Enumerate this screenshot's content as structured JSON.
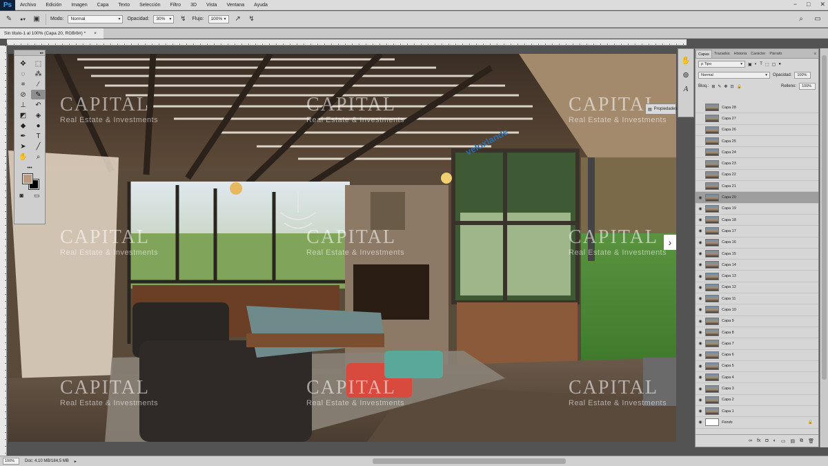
{
  "app": {
    "logo": "Ps"
  },
  "menubar": {
    "items": [
      "Archivo",
      "Edición",
      "Imagen",
      "Capa",
      "Texto",
      "Selección",
      "Filtro",
      "3D",
      "Vista",
      "Ventana",
      "Ayuda"
    ],
    "window_controls": [
      "−",
      "□",
      "✕"
    ]
  },
  "options_bar": {
    "mode_label": "Modo:",
    "mode_value": "Normal",
    "opacity_label": "Opacidad:",
    "opacity_value": "30%",
    "flow_label": "Flujo:",
    "flow_value": "100%"
  },
  "document": {
    "tab_title": "Sin título-1 al 100% (Capa 20, RGB/8#) *",
    "close_glyph": "×"
  },
  "toolbox": {
    "tools": [
      {
        "name": "move-tool-icon",
        "glyph": "✥"
      },
      {
        "name": "marquee-tool-icon",
        "glyph": "⬚"
      },
      {
        "name": "lasso-tool-icon",
        "glyph": "◌"
      },
      {
        "name": "magic-wand-tool-icon",
        "glyph": "⁂"
      },
      {
        "name": "crop-tool-icon",
        "glyph": "⌗"
      },
      {
        "name": "eyedropper-tool-icon",
        "glyph": "⁄"
      },
      {
        "name": "healing-brush-tool-icon",
        "glyph": "⊘"
      },
      {
        "name": "brush-tool-icon",
        "glyph": "✎",
        "active": true
      },
      {
        "name": "clone-stamp-tool-icon",
        "glyph": "⊥"
      },
      {
        "name": "history-brush-tool-icon",
        "glyph": "↶"
      },
      {
        "name": "eraser-tool-icon",
        "glyph": "◩"
      },
      {
        "name": "paint-bucket-tool-icon",
        "glyph": "◈"
      },
      {
        "name": "blur-tool-icon",
        "glyph": "◆"
      },
      {
        "name": "dodge-tool-icon",
        "glyph": "●"
      },
      {
        "name": "pen-tool-icon",
        "glyph": "✒"
      },
      {
        "name": "type-tool-icon",
        "glyph": "T"
      },
      {
        "name": "path-selection-tool-icon",
        "glyph": "➤"
      },
      {
        "name": "line-tool-icon",
        "glyph": "╱"
      },
      {
        "name": "hand-tool-icon",
        "glyph": "✋"
      },
      {
        "name": "zoom-tool-icon",
        "glyph": "⌕"
      }
    ],
    "more_glyph": "•••"
  },
  "canvas": {
    "watermarks": [
      {
        "title": "CAPITAL",
        "subtitle": "Real Estate & Investments"
      },
      {
        "title": "CAPITAL",
        "subtitle": "Real Estate & Investments"
      },
      {
        "title": "CAPITAL",
        "subtitle": "Real Estate & Investments"
      },
      {
        "title": "CAPITAL",
        "subtitle": "Real Estate & Investments"
      },
      {
        "title": "CAPITAL",
        "subtitle": "Real Estate & Investments"
      },
      {
        "title": "CAPITAL",
        "subtitle": "Real Estate & Investments"
      },
      {
        "title": "CAPITAL",
        "subtitle": "Real Estate & Investments"
      },
      {
        "title": "CAPITAL",
        "subtitle": "Real Estate & Investments"
      },
      {
        "title": "CAPITAL",
        "subtitle": "Real Estate & Investments"
      }
    ],
    "sign_text": "veloxlande",
    "nav_arrow": "›"
  },
  "properties_button": {
    "label": "Propiedades"
  },
  "layers_panel": {
    "tabs": [
      "Capas",
      "Trazados",
      "Historia",
      "Carácter",
      "Párrafo"
    ],
    "active_tab": "Capas",
    "filter_value": "ρ Tipo",
    "blend_value": "Normal",
    "opacity_label": "Opacidad:",
    "opacity_value": "100%",
    "lock_label": "Bloq.:",
    "fill_label": "Relleno:",
    "fill_value": "100%",
    "layers": [
      {
        "name": "Capa 28",
        "visible": false
      },
      {
        "name": "Capa 27",
        "visible": false
      },
      {
        "name": "Capa 26",
        "visible": false
      },
      {
        "name": "Capa 25",
        "visible": false
      },
      {
        "name": "Capa 24",
        "visible": false
      },
      {
        "name": "Capa 23",
        "visible": false
      },
      {
        "name": "Capa 22",
        "visible": false
      },
      {
        "name": "Capa 21",
        "visible": false
      },
      {
        "name": "Capa 20",
        "visible": true,
        "selected": true
      },
      {
        "name": "Capa 19",
        "visible": true
      },
      {
        "name": "Capa 18",
        "visible": true
      },
      {
        "name": "Capa 17",
        "visible": true
      },
      {
        "name": "Capa 16",
        "visible": true
      },
      {
        "name": "Capa 15",
        "visible": true
      },
      {
        "name": "Capa 14",
        "visible": true
      },
      {
        "name": "Capa 13",
        "visible": true
      },
      {
        "name": "Capa 12",
        "visible": true
      },
      {
        "name": "Capa 11",
        "visible": true
      },
      {
        "name": "Capa 10",
        "visible": true
      },
      {
        "name": "Capa 9",
        "visible": true
      },
      {
        "name": "Capa 8",
        "visible": true
      },
      {
        "name": "Capa 7",
        "visible": true
      },
      {
        "name": "Capa 6",
        "visible": true
      },
      {
        "name": "Capa 5",
        "visible": true
      },
      {
        "name": "Capa 4",
        "visible": true
      },
      {
        "name": "Capa 3",
        "visible": true
      },
      {
        "name": "Capa 2",
        "visible": true
      },
      {
        "name": "Capa 1",
        "visible": true
      },
      {
        "name": "Fondo",
        "visible": true,
        "locked": true
      }
    ],
    "footer_icons": [
      "∞",
      "fx",
      "◘",
      "◐",
      "▭",
      "▤",
      "⧉",
      "🗑"
    ]
  },
  "statusbar": {
    "zoom": "100%",
    "doc_info": "Doc: 4,10 MB/184,5 MB"
  },
  "colors": {
    "foreground": "#b89a80",
    "background": "#000000"
  }
}
